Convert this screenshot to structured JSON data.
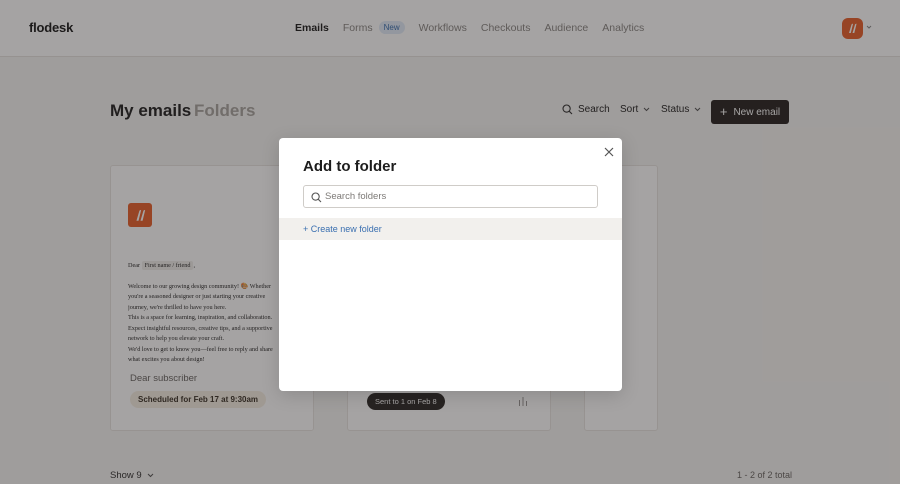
{
  "header": {
    "logo": "flodesk",
    "nav": [
      {
        "label": "Emails",
        "active": true
      },
      {
        "label": "Forms",
        "badge": "New"
      },
      {
        "label": "Workflows"
      },
      {
        "label": "Checkouts"
      },
      {
        "label": "Audience"
      },
      {
        "label": "Analytics"
      }
    ]
  },
  "page": {
    "title": "My emails",
    "tab_folders": "Folders",
    "toolbar": {
      "search": "Search",
      "sort": "Sort",
      "status": "Status",
      "new_email": "New email"
    }
  },
  "cards": [
    {
      "preview": {
        "dear": "Dear",
        "merge_tag": "First name / friend",
        "comma": ",",
        "lines": [
          "Welcome to our growing design community! 🎨 Whether",
          "you're a seasoned designer or just starting your creative",
          "journey, we're thrilled to have you here.",
          "This is a space for learning, inspiration, and collaboration.",
          "Expect insightful resources, creative tips, and a supportive",
          "network to help you elevate your craft.",
          "We'd love to get to know you—feel free to reply and share",
          "what excites you about design!"
        ]
      },
      "subject": "Dear subscriber",
      "status": "Scheduled for Feb 17 at 9:30am"
    },
    {
      "status": "Sent to 1 on Feb 8"
    }
  ],
  "footer": {
    "show": "Show 9",
    "total": "1 - 2 of 2 total"
  },
  "modal": {
    "title": "Add to folder",
    "search_placeholder": "Search folders",
    "create_label": "+ Create new folder"
  },
  "colors": {
    "brand_orange": "#e8622d",
    "link_blue": "#3a6fb0",
    "dark_button": "#2a2624"
  }
}
